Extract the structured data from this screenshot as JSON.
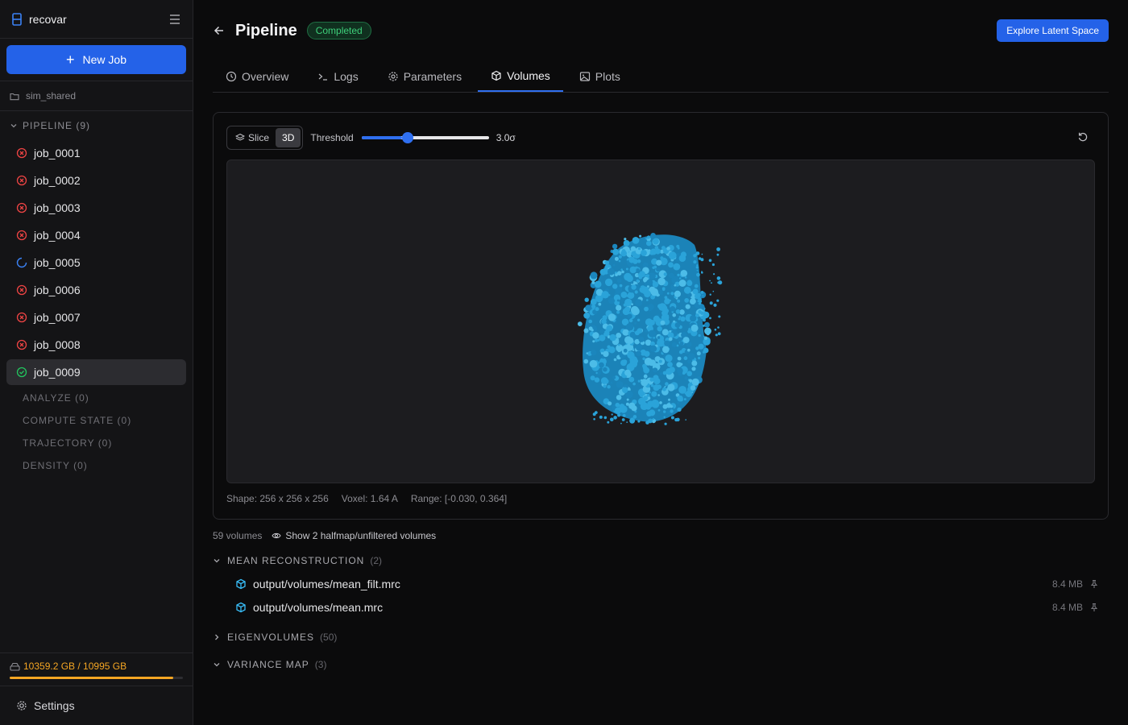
{
  "app": {
    "name": "recovar"
  },
  "sidebar": {
    "new_job_label": "New Job",
    "project": "sim_shared",
    "pipeline_heading": "PIPELINE (9)",
    "jobs": [
      {
        "name": "job_0001",
        "status": "failed"
      },
      {
        "name": "job_0002",
        "status": "failed"
      },
      {
        "name": "job_0003",
        "status": "failed"
      },
      {
        "name": "job_0004",
        "status": "failed"
      },
      {
        "name": "job_0005",
        "status": "running"
      },
      {
        "name": "job_0006",
        "status": "failed"
      },
      {
        "name": "job_0007",
        "status": "failed"
      },
      {
        "name": "job_0008",
        "status": "failed"
      },
      {
        "name": "job_0009",
        "status": "completed"
      }
    ],
    "sections": [
      "ANALYZE (0)",
      "COMPUTE STATE (0)",
      "TRAJECTORY (0)",
      "DENSITY (0)"
    ],
    "storage": {
      "label": "10359.2 GB / 10995 GB",
      "fraction": 0.942
    },
    "settings_label": "Settings"
  },
  "header": {
    "title": "Pipeline",
    "status_badge": "Completed",
    "explore_button": "Explore Latent Space"
  },
  "tabs": [
    {
      "label": "Overview",
      "icon": "clock-icon"
    },
    {
      "label": "Logs",
      "icon": "terminal-icon"
    },
    {
      "label": "Parameters",
      "icon": "gear-icon"
    },
    {
      "label": "Volumes",
      "icon": "cube-icon",
      "active": true
    },
    {
      "label": "Plots",
      "icon": "image-icon"
    }
  ],
  "viewer": {
    "mode_slice": "Slice",
    "mode_3d": "3D",
    "active_mode": "3D",
    "threshold_label": "Threshold",
    "threshold_value": "3.0σ",
    "threshold_fraction": 0.32,
    "shape": "Shape: 256 x 256 x 256",
    "voxel": "Voxel: 1.64 A",
    "range": "Range: [-0.030, 0.364]",
    "render_color": "#2aa3d9"
  },
  "volumes": {
    "count_label": "59 volumes",
    "toggle_label": "Show 2 halfmap/unfiltered volumes",
    "groups": [
      {
        "name": "MEAN RECONSTRUCTION",
        "count": "(2)",
        "expanded": true,
        "files": [
          {
            "path": "output/volumes/mean_filt.mrc",
            "size": "8.4 MB"
          },
          {
            "path": "output/volumes/mean.mrc",
            "size": "8.4 MB"
          }
        ]
      },
      {
        "name": "EIGENVOLUMES",
        "count": "(50)",
        "expanded": false
      },
      {
        "name": "VARIANCE MAP",
        "count": "(3)",
        "expanded": true
      }
    ]
  }
}
